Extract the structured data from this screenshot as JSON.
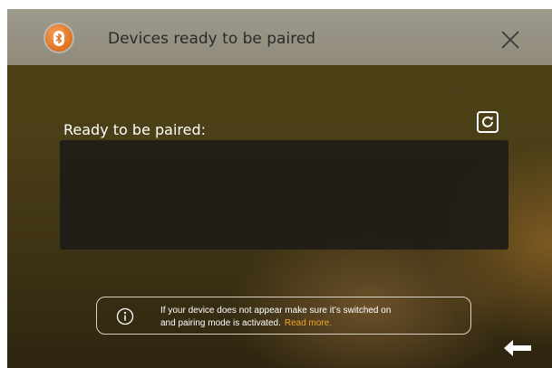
{
  "window": {
    "title": "Devices ready to be paired",
    "app_icon": "bluetooth-icon",
    "close_icon": "close-icon"
  },
  "main": {
    "section_label": "Ready to be paired:",
    "refresh_icon": "refresh-icon",
    "devices": []
  },
  "info": {
    "icon": "info-icon",
    "line1": "If your device does not appear make sure it’s switched on",
    "line2": "and pairing mode is activated.",
    "read_more": "Read more."
  },
  "footer": {
    "back_icon": "back-arrow-icon"
  },
  "colors": {
    "accent": "#f0a52a",
    "logo_orange": "#e0701e"
  }
}
